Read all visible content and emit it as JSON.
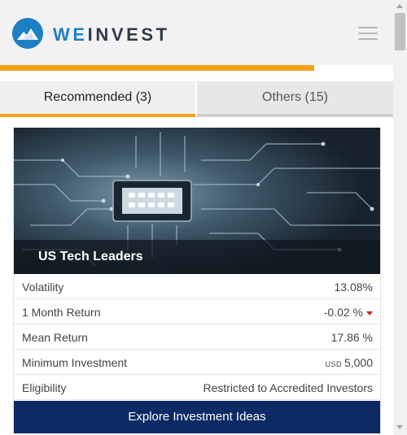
{
  "brand": {
    "logo_prefix": "WE",
    "logo_suffix": "INVEST",
    "accent_color": "#1f7fc4",
    "progress_color": "#f4a11a"
  },
  "header": {
    "menu_icon": "hamburger-menu-icon"
  },
  "progress": {
    "fraction": 0.8
  },
  "tabs": [
    {
      "label": "Recommended (3)",
      "active": true
    },
    {
      "label": "Others (15)",
      "active": false
    }
  ],
  "card": {
    "title": "US Tech Leaders",
    "rows": [
      {
        "label": "Volatility",
        "value": "13.08%"
      },
      {
        "label": "1 Month Return",
        "value": "-0.02 %",
        "trend": "down",
        "trend_color": "#d62020"
      },
      {
        "label": "Mean Return",
        "value": "17.86 %"
      },
      {
        "label": "Minimum Investment",
        "currency": "USD",
        "value": "5,000"
      },
      {
        "label": "Eligibility",
        "value": "Restricted to Accredited Investors"
      }
    ],
    "cta_label": "Explore Investment Ideas",
    "cta_color": "#0c2a64"
  }
}
